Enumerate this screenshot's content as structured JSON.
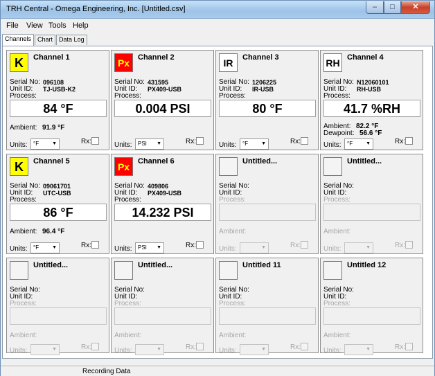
{
  "window": {
    "title": "TRH Central - Omega Engineering, Inc. [Untitled.csv]",
    "min": "–",
    "max": "□",
    "close": "✕"
  },
  "menu": [
    "File",
    "View",
    "Tools",
    "Help"
  ],
  "tabs": [
    "Channels",
    "Chart",
    "Data Log"
  ],
  "active_tab": "Channels",
  "labels": {
    "serial": "Serial No:",
    "unit": "Unit ID:",
    "process": "Process:",
    "ambient": "Ambient:",
    "dewpoint": "Dewpoint:",
    "units": "Units:",
    "rx": "Rx:"
  },
  "channels": [
    {
      "title": "Channel 1",
      "badge": "K",
      "serial": "096108",
      "unit_id": "TJ-USB-K2",
      "process": "84 °F",
      "ambient": "91.9 °F",
      "units": "°F"
    },
    {
      "title": "Channel 2",
      "badge": "Px",
      "serial": "431595",
      "unit_id": "PX409-USB",
      "process": "0.004 PSI",
      "units": "PSI"
    },
    {
      "title": "Channel 3",
      "badge": "IR",
      "serial": "1206225",
      "unit_id": "IR-USB",
      "process": "80 °F",
      "units": "°F"
    },
    {
      "title": "Channel 4",
      "badge": "RH",
      "serial": "N12060101",
      "unit_id": "RH-USB",
      "process": "41.7 %RH",
      "ambient": "82.2 °F",
      "dewpoint": "56.6 °F",
      "units": "°F"
    },
    {
      "title": "Channel 5",
      "badge": "K",
      "serial": "09061701",
      "unit_id": "UTC-USB",
      "process": "86 °F",
      "ambient": "96.4 °F",
      "units": "°F"
    },
    {
      "title": "Channel 6",
      "badge": "Px",
      "serial": "409806",
      "unit_id": "PX409-USB",
      "process": "14.232 PSI",
      "units": "PSI"
    },
    {
      "title": "Untitled..."
    },
    {
      "title": "Untitled..."
    },
    {
      "title": "Untitled..."
    },
    {
      "title": "Untitled..."
    },
    {
      "title": "Untitled 11"
    },
    {
      "title": "Untitled 12"
    }
  ],
  "status": "Recording Data"
}
